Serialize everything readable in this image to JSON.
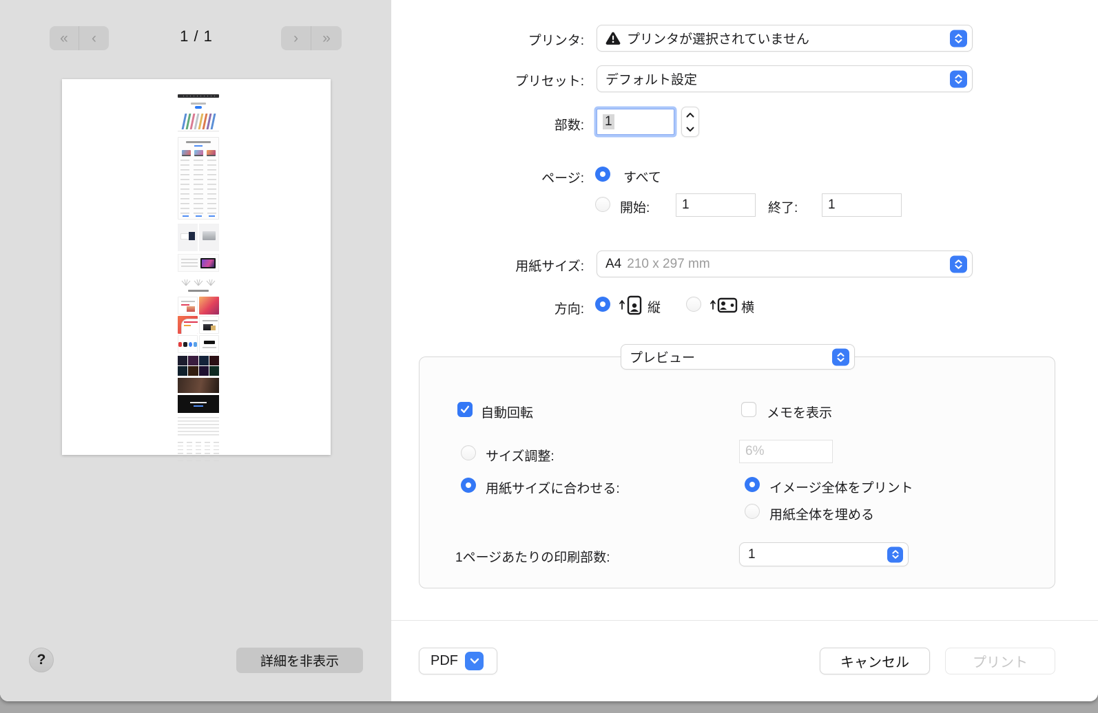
{
  "accent": "#3478F6",
  "preview_pane": {
    "page_indicator": "1 / 1",
    "nav": {
      "first": "«",
      "prev": "‹",
      "next": "›",
      "last": "»"
    },
    "help_label": "?",
    "hide_details_label": "詳細を非表示"
  },
  "form": {
    "printer": {
      "label": "プリンタ:",
      "value": "プリンタが選択されていません"
    },
    "presets": {
      "label": "プリセット:",
      "value": "デフォルト設定"
    },
    "copies": {
      "label": "部数:",
      "value": "1"
    },
    "pages": {
      "label": "ページ:",
      "all_label": "すべて",
      "from_label": "開始:",
      "from_value": "1",
      "to_label": "終了:",
      "to_value": "1"
    },
    "paper_size": {
      "label": "用紙サイズ:",
      "value": "A4",
      "dims": "210 x 297 mm"
    },
    "orientation": {
      "label": "方向:",
      "portrait_label": "縦",
      "landscape_label": "横"
    }
  },
  "panel": {
    "pane_selector_value": "プレビュー",
    "auto_rotate_label": "自動回転",
    "show_notes_label": "メモを表示",
    "scale_label": "サイズ調整:",
    "scale_value": "6%",
    "scale_to_fit_label": "用紙サイズに合わせる:",
    "print_entire_image_label": "イメージ全体をプリント",
    "fill_entire_paper_label": "用紙全体を埋める",
    "copies_per_page_label": "1ページあたりの印刷部数:",
    "copies_per_page_value": "1"
  },
  "footer": {
    "pdf_label": "PDF",
    "cancel_label": "キャンセル",
    "print_label": "プリント"
  }
}
